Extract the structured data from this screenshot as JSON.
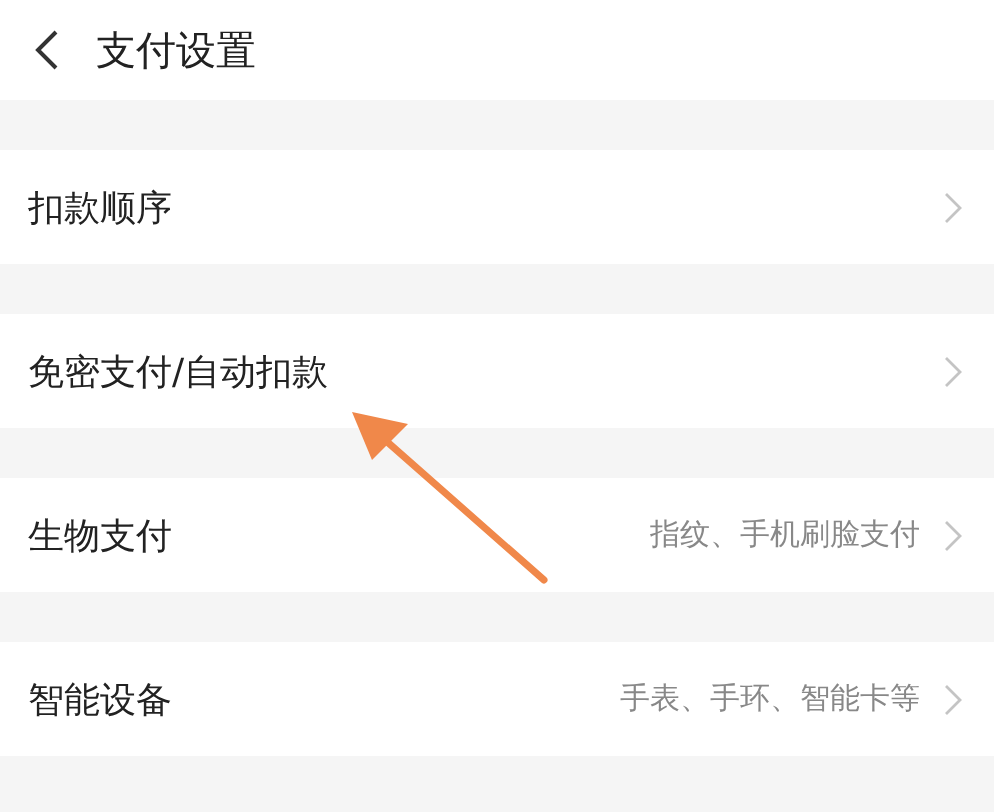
{
  "header": {
    "title": "支付设置"
  },
  "rows": [
    {
      "label": "扣款顺序"
    },
    {
      "label": "免密支付/自动扣款"
    },
    {
      "label": "生物支付",
      "value": "指纹、手机刷脸支付"
    },
    {
      "label": "智能设备",
      "value": "手表、手环、智能卡等"
    }
  ]
}
